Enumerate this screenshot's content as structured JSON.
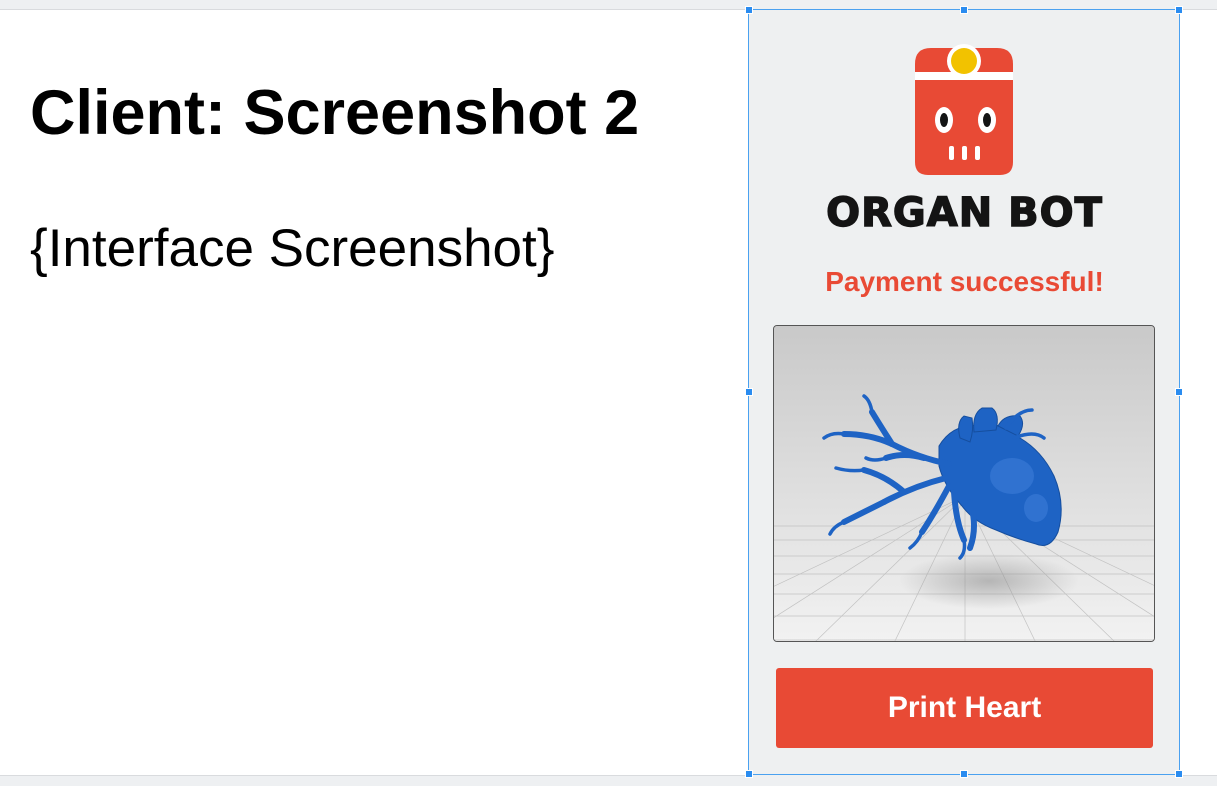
{
  "slide": {
    "title": "Client: Screenshot 2",
    "subtitle": "{Interface Screenshot}"
  },
  "app": {
    "brand_name": "ORGAN BOT",
    "status_message": "Payment successful!",
    "model_image": "3d-heart-model",
    "print_button_label": "Print Heart",
    "colors": {
      "accent": "#e84a35",
      "logo_eye": "#f2c200",
      "model": "#1e63c4",
      "panel_background": "#eef0f1",
      "selection": "#4aa1f0"
    }
  }
}
